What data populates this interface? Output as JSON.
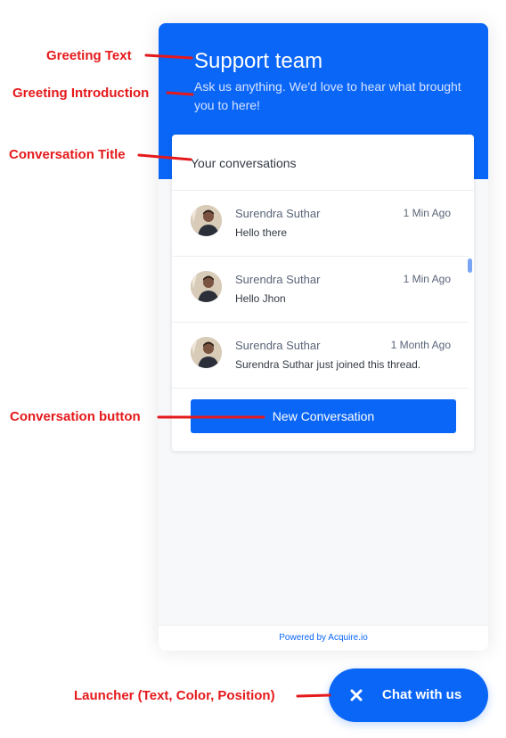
{
  "colors": {
    "accent": "#0a66f7",
    "annotation": "#e5191b"
  },
  "widget": {
    "greeting": "Support team",
    "introduction": "Ask us anything. We'd love to hear what brought you to here!",
    "conversations_title": "Your conversations",
    "conversations": [
      {
        "sender": "Surendra Suthar",
        "time": "1 Min Ago",
        "preview": "Hello there"
      },
      {
        "sender": "Surendra Suthar",
        "time": "1 Min Ago",
        "preview": "Hello Jhon"
      },
      {
        "sender": "Surendra Suthar",
        "time": "1 Month Ago",
        "preview": "Surendra Suthar just joined this thread."
      }
    ],
    "new_conversation_label": "New Conversation",
    "footer": {
      "prefix": "Powered by",
      "brand": "Acquire.io"
    }
  },
  "launcher": {
    "label": "Chat with us",
    "icon": "close-icon"
  },
  "annotations": {
    "greeting_text": "Greeting Text",
    "greeting_introduction": "Greeting Introduction",
    "conversation_title": "Conversation Title",
    "conversation_button": "Conversation button",
    "launcher": "Launcher (Text, Color, Position)"
  }
}
